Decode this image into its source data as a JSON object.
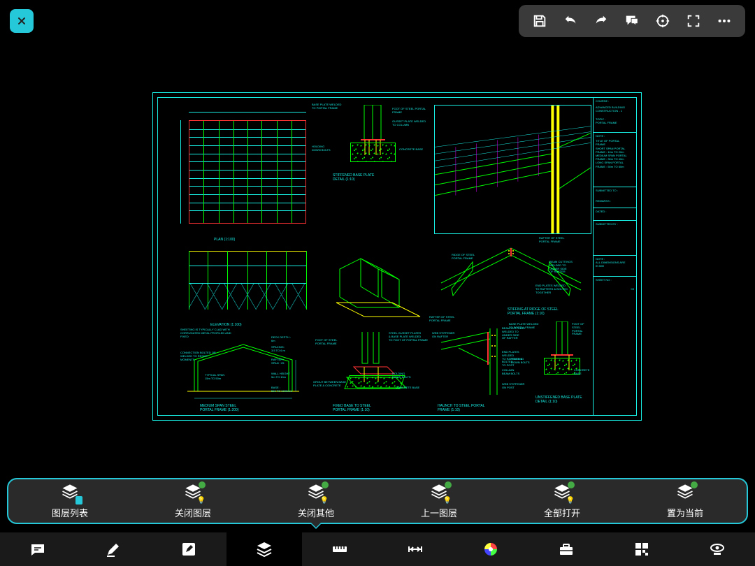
{
  "topbar": {
    "close": "close",
    "actions": {
      "save": "save",
      "undo": "undo",
      "redo": "redo",
      "comment": "comment",
      "reticle": "reticle",
      "fullscreen": "fullscreen",
      "more": "more"
    }
  },
  "drawing": {
    "plan_title": "PLAN (1:100)",
    "elev_title": "ELEVATION  (1:100)",
    "section_title": "MEDIUM  SPAN STEEL\nPORTAL FRAME  (1:200)",
    "baseplate_title": "STIFFENED BASE PLATE\nDETAIL (1:10)",
    "fixedbase_title": "FIXED BASE TO STEEL\nPORTAL FRAME (1:10)",
    "ridge_title": "STIFFING AT RIDGE OF STEEL\nPORTAL FRAME (1:10)",
    "haunch_title": "HAUNCH TO STEEL PORTAL\nFRAME (1:10)",
    "unstiff_title": "UNSTIFFENED BASE PLATE\nDETAIL (1:10)",
    "callouts": {
      "base_plate_welded": "BASE PLATE WELDED\nTO PORTAL FRAME",
      "foot_steel_portal": "FOOT OF STEEL PORTAL\nFRAME",
      "gusset_plate": "GUSSET PLATE WELDED\nTO COLUMN",
      "holding_down_bolts": "HOLDING\nDOWN BOLTS",
      "concrete_base": "CONCRETE BASE",
      "rafter_steel": "RAFTER OF STEEL\nPORTAL FRAME",
      "ridge_steel": "RIDGE OF STEEL\nPORTAL FRAME",
      "beam_cut": "BEAM CUTTINGS\nWELDED TO\nUNDER SIDE\nOF RAFTER",
      "end_plates": "END PLATES WELDED\nTO RAFTERS & BOLTED\nTOGETHER",
      "web_stiffener": "WEB STIFFENER\nON RAFTER",
      "steel_gusset": "STEEL GUSSET PLATES\n& BASE PLATE WELDED\nTO FOOT OF PORTAL FRAME",
      "grout": "GROUT BETWEEN BASE\nPLATE & CONCRETE",
      "end_plates2": "END PLATES WELDED\nTO RAFTERS & BOLTED\nTO POST",
      "column_beam": "COLUMN\nBEAM BOLTS",
      "web_stiff2": "WEB STIFFENER\nON POST",
      "sheeting": "SHEETING IS TYPICALLY CLAD WITH\nCORRUGATED METAL PROFILED AND\nFIXED",
      "connection": "CONNECTION BOLTED OR\nWELDED TO RESIST\nMOMENTS",
      "typical_span": "TYPICAL SPAN\n15m TO 50m",
      "deck_depth": "DECK DEPTH :\n6m",
      "spacing": "SPACING:\n3.5 TO 6 m",
      "rafter_span": "RAFTER :\nSPAN ~25",
      "wall_height": "WALL HEIGHT\n5m TO 10m",
      "base": "BASE :\n500  TO 1000mm",
      "foot2": "FOOT OF STEEL\nPORTAL FRAME"
    },
    "titleblock": {
      "course": "COURSE :",
      "course_v": "ADVANCED\nBUILDING\nCONSTRUCTION - 1",
      "topic": "TOPIC :",
      "topic_v": "PORTAL FRAME",
      "note": "NOTE :",
      "note_v": "TITLE OF PORTAL\nFRAME\nSHORT SPAN PORTAL\nFRAME : 10m TO 20m\nMEDIUM SPAN PORTAL\nFRAME : 30m TO 40m\nLONG SPAN PORTAL\nFRAME : 50m TO 60m",
      "submitted_to": "SUBMITTED TO :",
      "remarks": "REMARKS :",
      "dated": "DATED :",
      "submitted_by": "SUBMITTED BY :",
      "note2": "NOTE :",
      "note2_v": "ALL DIMENSIONS ARE\nIN MM",
      "sheet": "SHEET NO :",
      "sheet_v": "03"
    }
  },
  "layer_toolbar": {
    "list": "图层列表",
    "close_layer": "关闭图层",
    "close_other": "关闭其他",
    "prev_layer": "上一图层",
    "open_all": "全部打开",
    "set_current": "置为当前"
  },
  "bottom_toolbar": {
    "note": "note",
    "pencil": "pencil",
    "edit": "edit",
    "layers": "layers",
    "measure": "measure",
    "dimension": "dimension",
    "color": "color",
    "toolbox": "toolbox",
    "grid": "grid",
    "view": "view"
  }
}
